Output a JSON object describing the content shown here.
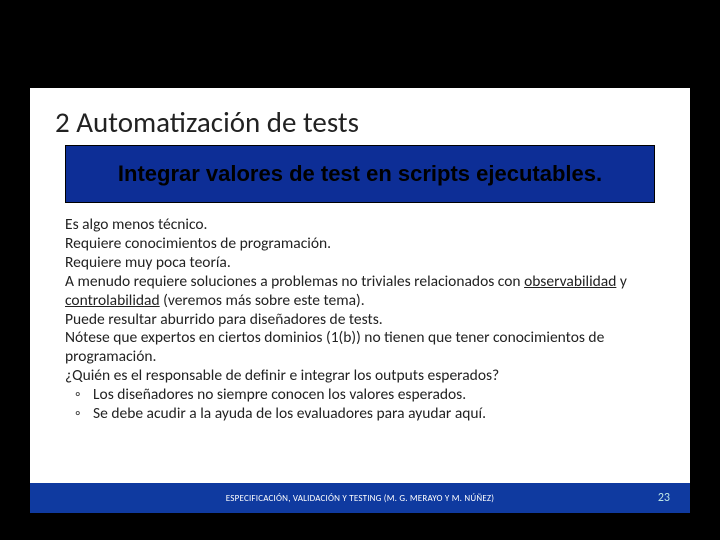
{
  "slide": {
    "title": "2 Automatización de tests",
    "banner": "Integrar valores de test en scripts ejecutables.",
    "lines": {
      "l1": "Es algo menos técnico.",
      "l2": "Requiere conocimientos de programación.",
      "l3": "Requiere muy poca teoría.",
      "l4a": "A menudo requiere soluciones a problemas no triviales relacionados con ",
      "l4u1": "observabilidad",
      "l4mid": " y ",
      "l4u2": "controlabilidad",
      "l4b": " (veremos más sobre este tema).",
      "l5": "Puede resultar aburrido para diseñadores de tests.",
      "l6": "Nótese que expertos en ciertos dominios (1(b)) no tienen que tener conocimientos de programación.",
      "l7": "¿Quién es el responsable de definir e integrar los outputs esperados?",
      "s1": "Los diseñadores no siempre conocen los valores esperados.",
      "s2": "Se debe acudir a la ayuda de los evaluadores para ayudar aquí."
    },
    "footer": "ESPECIFICACIÓN, VALIDACIÓN Y TESTING (M. G. MERAYO Y M. NÚÑEZ)",
    "page": "23"
  }
}
